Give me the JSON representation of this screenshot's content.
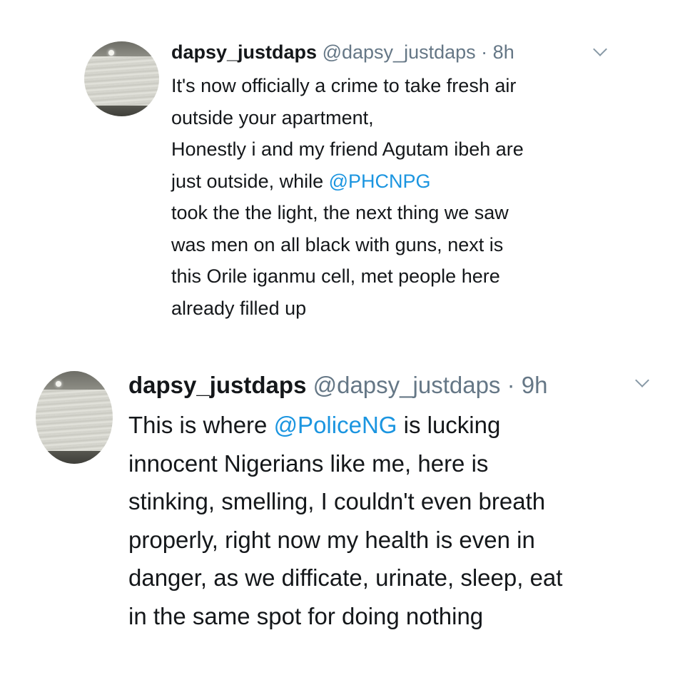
{
  "tweets": [
    {
      "name": "dapsy_justdaps",
      "handle": "@dapsy_justdaps",
      "separator": "·",
      "time": "8h",
      "lines": [
        [
          {
            "text": "It's now officially a crime to take fresh air"
          }
        ],
        [
          {
            "text": "outside your apartment,"
          }
        ],
        [
          {
            "text": "Honestly i and my friend Agutam ibeh are"
          }
        ],
        [
          {
            "text": "just outside, while "
          },
          {
            "text": "@PHCNPG",
            "mention": true
          }
        ],
        [
          {
            "text": "took the the light, the next thing we saw"
          }
        ],
        [
          {
            "text": "was men on all black with guns, next is"
          }
        ],
        [
          {
            "text": "this Orile iganmu cell, met people here"
          }
        ],
        [
          {
            "text": "already filled up"
          }
        ]
      ]
    },
    {
      "name": "dapsy_justdaps",
      "handle": "@dapsy_justdaps",
      "separator": "·",
      "time": "9h",
      "lines": [
        [
          {
            "text": "This is where "
          },
          {
            "text": "@PoliceNG",
            "mention": true
          },
          {
            "text": " is lucking"
          }
        ],
        [
          {
            "text": "innocent Nigerians like me, here is"
          }
        ],
        [
          {
            "text": "stinking, smelling, I couldn't even breath"
          }
        ],
        [
          {
            "text": "properly, right now my health is even in"
          }
        ],
        [
          {
            "text": "danger, as we difficate, urinate, sleep, eat"
          }
        ],
        [
          {
            "text": "in the same spot for doing nothing"
          }
        ]
      ]
    }
  ],
  "icons": {
    "avatar": "avatar-photo-wall",
    "menu": "chevron-down-icon"
  },
  "colors": {
    "text": "#14171a",
    "secondary": "#657786",
    "mention": "#1b95e0",
    "background": "#ffffff"
  }
}
